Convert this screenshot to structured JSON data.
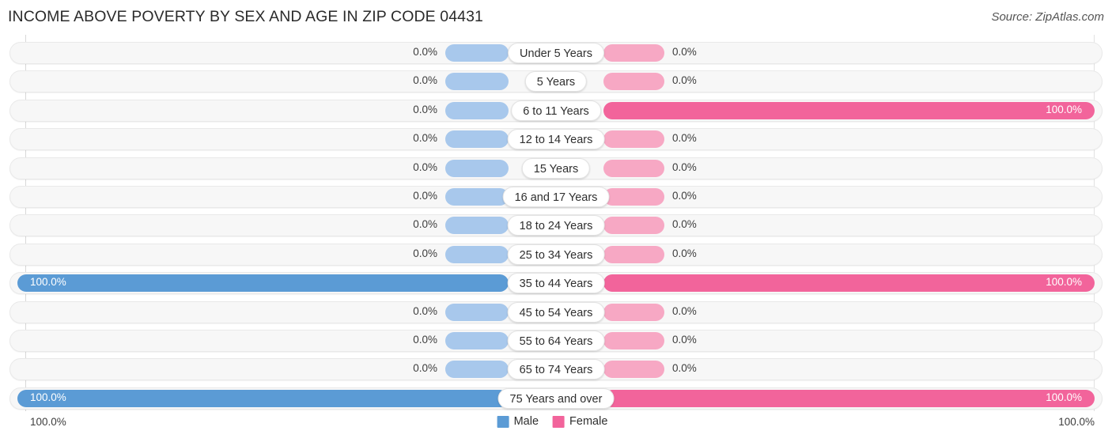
{
  "header": {
    "title": "INCOME ABOVE POVERTY BY SEX AND AGE IN ZIP CODE 04431",
    "source": "Source: ZipAtlas.com"
  },
  "footer": {
    "axis_left": "100.0%",
    "axis_right": "100.0%",
    "legend": [
      {
        "label": "Male",
        "color": "#5b9bd5"
      },
      {
        "label": "Female",
        "color": "#f2649b"
      }
    ]
  },
  "colors": {
    "male_light": "#a8c8ec",
    "male_full": "#5b9bd5",
    "female_light": "#f7a8c4",
    "female_full": "#f2649b",
    "track": "#f7f7f7",
    "text": "#2f2f2f"
  },
  "chart_data": {
    "type": "bar",
    "title": "INCOME ABOVE POVERTY BY SEX AND AGE IN ZIP CODE 04431",
    "subtitle": "",
    "xlabel": "",
    "ylabel": "",
    "orientation": "horizontal",
    "style": "diverging-bidirectional",
    "xlim": [
      0,
      100
    ],
    "grid": false,
    "legend_position": "bottom-center",
    "categories": [
      "Under 5 Years",
      "5 Years",
      "6 to 11 Years",
      "12 to 14 Years",
      "15 Years",
      "16 and 17 Years",
      "18 to 24 Years",
      "25 to 34 Years",
      "35 to 44 Years",
      "45 to 54 Years",
      "55 to 64 Years",
      "65 to 74 Years",
      "75 Years and over"
    ],
    "series": [
      {
        "name": "Male",
        "direction": "left",
        "values": [
          0.0,
          0.0,
          0.0,
          0.0,
          0.0,
          0.0,
          0.0,
          0.0,
          100.0,
          0.0,
          0.0,
          0.0,
          100.0
        ],
        "labels": [
          "0.0%",
          "0.0%",
          "0.0%",
          "0.0%",
          "0.0%",
          "0.0%",
          "0.0%",
          "0.0%",
          "100.0%",
          "0.0%",
          "0.0%",
          "0.0%",
          "100.0%"
        ]
      },
      {
        "name": "Female",
        "direction": "right",
        "values": [
          0.0,
          0.0,
          100.0,
          0.0,
          0.0,
          0.0,
          0.0,
          0.0,
          100.0,
          0.0,
          0.0,
          0.0,
          100.0
        ],
        "labels": [
          "0.0%",
          "0.0%",
          "100.0%",
          "0.0%",
          "0.0%",
          "0.0%",
          "0.0%",
          "0.0%",
          "100.0%",
          "0.0%",
          "0.0%",
          "0.0%",
          "100.0%"
        ]
      }
    ]
  }
}
